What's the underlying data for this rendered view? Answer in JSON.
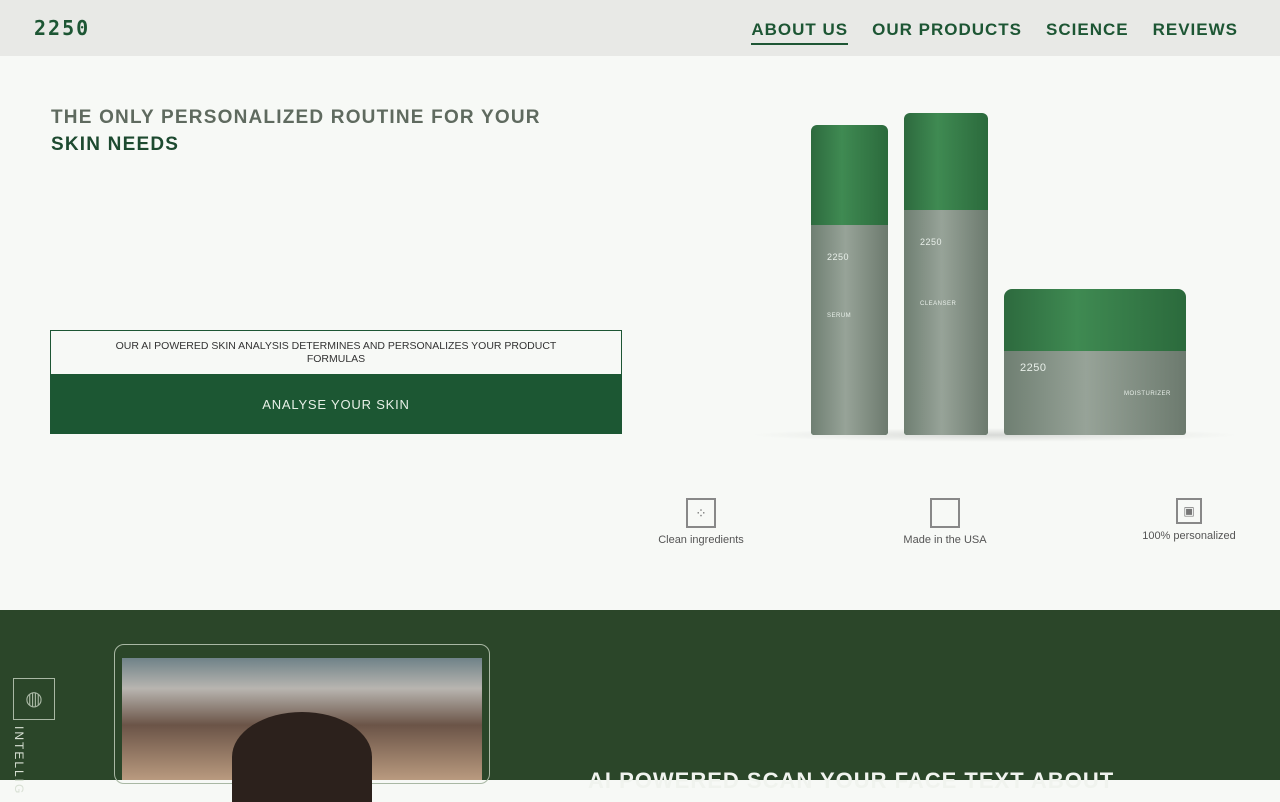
{
  "brand": {
    "logo": "2250"
  },
  "nav": {
    "items": [
      "ABOUT US",
      "OUR PRODUCTS",
      "SCIENCE",
      "REVIEWS"
    ],
    "active": "ABOUT US"
  },
  "hero": {
    "title_line1": "THE ONLY PERSONALIZED ROUTINE FOR YOUR",
    "title_line2": "SKIN NEEDS",
    "description": "OUR AI POWERED SKIN ANALYSIS DETERMINES AND PERSONALIZES YOUR PRODUCT FORMULAS",
    "cta": "ANALYSE YOUR SKIN"
  },
  "products": [
    {
      "label": "SERUM"
    },
    {
      "label": "CLEANSER"
    },
    {
      "label": "MOISTURIZER"
    }
  ],
  "features": [
    {
      "label": "Clean ingredients",
      "icon": "molecules-icon"
    },
    {
      "label": "Made in the USA",
      "icon": "flag-icon"
    },
    {
      "label": "100% personalized",
      "icon": "jar-icon"
    }
  ],
  "section2": {
    "side_label": "INTELLIG",
    "headline": "AI POWERED SCAN YOUR FACE TEXT ABOUT"
  },
  "colors": {
    "brand_green": "#1c5733",
    "dark_section": "#2b4629"
  }
}
